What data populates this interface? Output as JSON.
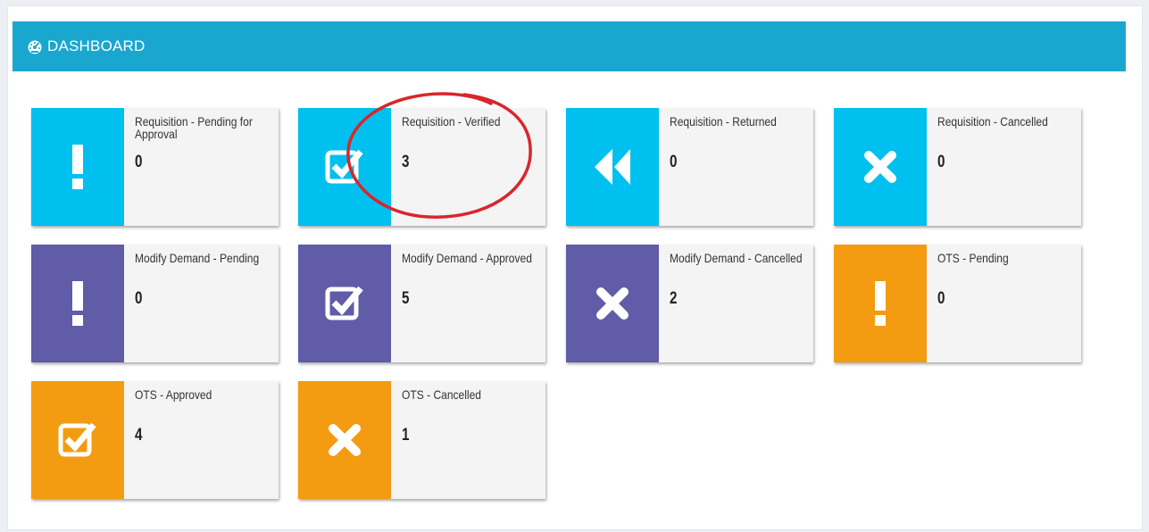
{
  "header": {
    "title": "DASHBOARD",
    "icon": "dashboard-icon",
    "color": "#1aa7cf"
  },
  "colors": {
    "aqua": "#00c0ef",
    "purple": "#605ca8",
    "orange": "#f39c12",
    "annotation": "#d9262b"
  },
  "tiles": [
    {
      "label": "Requisition - Pending for Approval",
      "count": "0",
      "icon": "exclamation-icon",
      "color": "aqua"
    },
    {
      "label": "Requisition - Verified",
      "count": "3",
      "icon": "check-square-icon",
      "color": "aqua"
    },
    {
      "label": "Requisition - Returned",
      "count": "0",
      "icon": "backward-icon",
      "color": "aqua"
    },
    {
      "label": "Requisition - Cancelled",
      "count": "0",
      "icon": "times-icon",
      "color": "aqua"
    },
    {
      "label": "Modify Demand - Pending",
      "count": "0",
      "icon": "exclamation-icon",
      "color": "purple"
    },
    {
      "label": "Modify Demand - Approved",
      "count": "5",
      "icon": "check-square-icon",
      "color": "purple"
    },
    {
      "label": "Modify Demand - Cancelled",
      "count": "2",
      "icon": "times-icon",
      "color": "purple"
    },
    {
      "label": "OTS - Pending",
      "count": "0",
      "icon": "exclamation-icon",
      "color": "orange"
    },
    {
      "label": "OTS - Approved",
      "count": "4",
      "icon": "check-square-icon",
      "color": "orange"
    },
    {
      "label": "OTS - Cancelled",
      "count": "1",
      "icon": "times-icon",
      "color": "orange"
    }
  ]
}
